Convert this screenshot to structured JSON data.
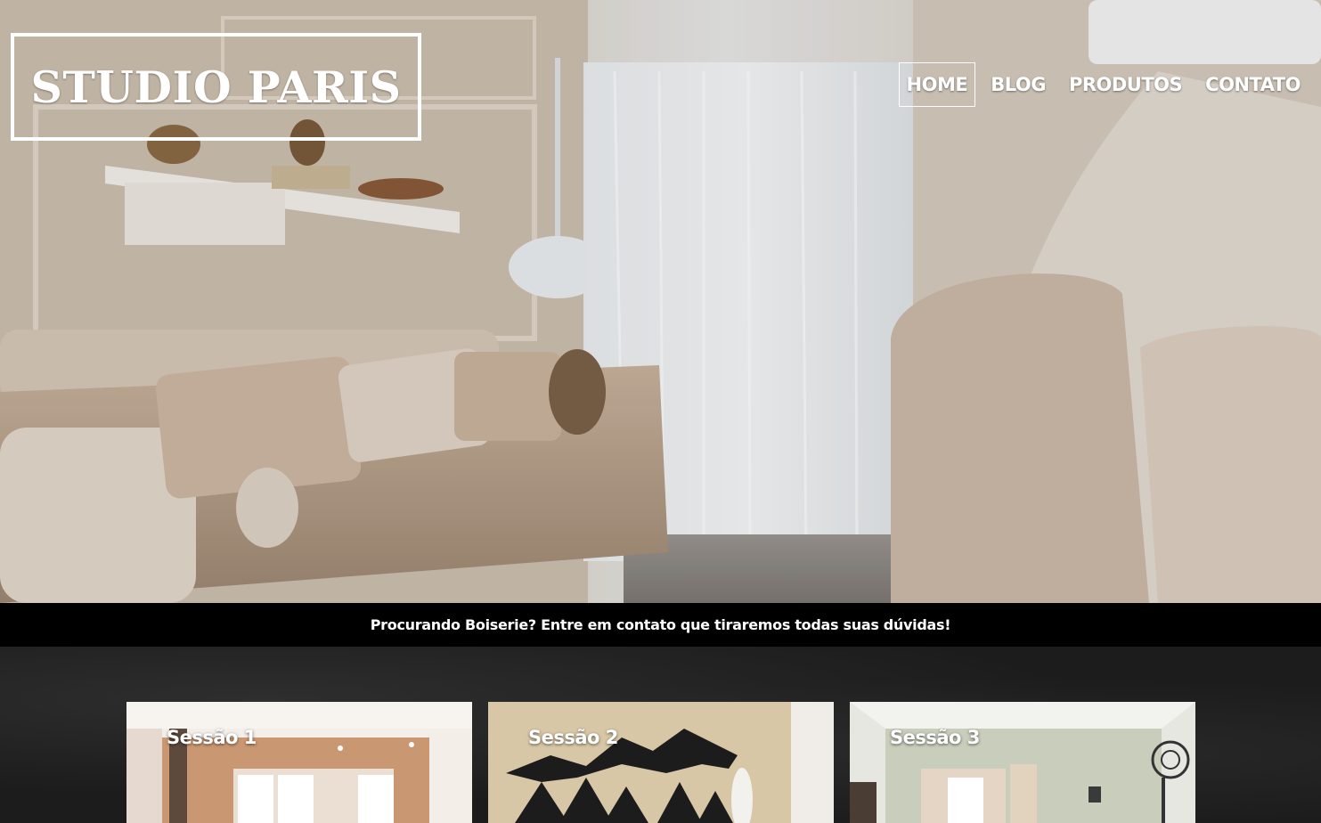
{
  "header": {
    "logo_text": "STUDIO PARIS",
    "nav": [
      {
        "label": "HOME",
        "active": true
      },
      {
        "label": "BLOG",
        "active": false
      },
      {
        "label": "PRODUTOS",
        "active": false
      },
      {
        "label": "CONTATO",
        "active": false
      }
    ]
  },
  "banner": {
    "text": "Procurando Boiserie? Entre em contato que tiraremos todas suas dúvidas!"
  },
  "sections": [
    {
      "title": "Sessão 1"
    },
    {
      "title": "Sessão 2"
    },
    {
      "title": "Sessão 3"
    }
  ],
  "colors": {
    "banner_bg": "#000000",
    "text": "#ffffff",
    "sections_bg": "#1c1c1c"
  }
}
